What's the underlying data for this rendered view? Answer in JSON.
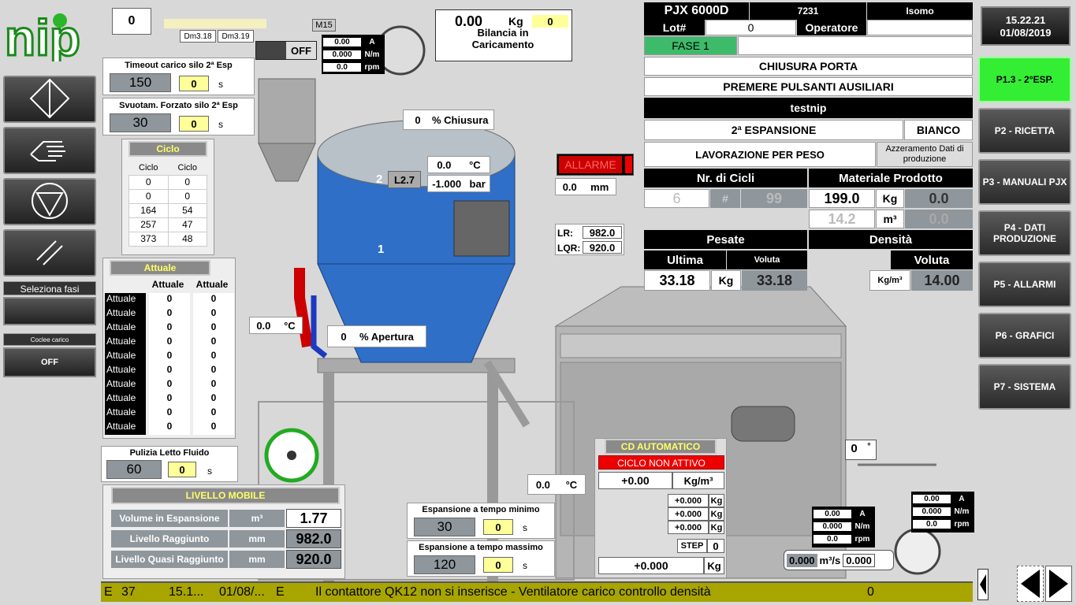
{
  "left": {
    "seleziona_fasi": "Seleziona fasi",
    "coclee_label": "Coclee carico",
    "coclee_value": "OFF"
  },
  "silo": {
    "counter": "0",
    "dm1": "Dm3.18",
    "dm2": "Dm3.19",
    "m15": "M15",
    "off": "OFF"
  },
  "timeout": {
    "title": "Timeout carico silo 2ª Esp",
    "value": "150",
    "actual": "0",
    "unit": "s"
  },
  "svuot": {
    "title": "Svuotam. Forzato silo 2ª Esp",
    "value": "30",
    "actual": "0",
    "unit": "s"
  },
  "ciclo": {
    "header": "Ciclo",
    "col1": "Ciclo",
    "col2": "Ciclo",
    "rows": [
      [
        "0",
        "0"
      ],
      [
        "0",
        "0"
      ],
      [
        "164",
        "54"
      ],
      [
        "257",
        "47"
      ],
      [
        "373",
        "48"
      ]
    ]
  },
  "attuale": {
    "header": "Attuale",
    "col1": "Attuale",
    "col2": "Attuale",
    "row_label": "Attuale",
    "rows": [
      [
        "0",
        "0"
      ],
      [
        "0",
        "0"
      ],
      [
        "0",
        "0"
      ],
      [
        "0",
        "0"
      ],
      [
        "0",
        "0"
      ],
      [
        "0",
        "0"
      ],
      [
        "0",
        "0"
      ],
      [
        "0",
        "0"
      ],
      [
        "0",
        "0"
      ],
      [
        "0",
        "0"
      ]
    ]
  },
  "pulizia": {
    "title": "Pulizia Letto Fluido",
    "value": "60",
    "actual": "0",
    "unit": "s"
  },
  "livello": {
    "header": "LIVELLO MOBILE",
    "rows": [
      {
        "label": "Volume in Espansione",
        "unit": "m³",
        "value": "1.77"
      },
      {
        "label": "Livello Raggiunto",
        "unit": "mm",
        "value": "982.0"
      },
      {
        "label": "Livello Quasi Raggiunto",
        "unit": "mm",
        "value": "920.0"
      }
    ]
  },
  "motor1": {
    "a": "0.00",
    "a_u": "A",
    "nm": "0.000",
    "nm_u": "N/m",
    "rpm": "0.0",
    "rpm_u": "rpm"
  },
  "bilancia": {
    "value": "0.00",
    "unit": "Kg",
    "actual": "0",
    "label": "Bilancia in Caricamento"
  },
  "chiusura": {
    "value": "0",
    "label": "% Chiusura"
  },
  "apertura": {
    "value": "0",
    "label": "% Apertura"
  },
  "tank": {
    "temp": "0.0",
    "temp_u": "°C",
    "bar": "-1.000",
    "bar_u": "bar",
    "l27": "L2.7",
    "n1": "1",
    "n2": "2",
    "t_left": "0.0",
    "t_left_u": "°C",
    "t_bottom": "0.0",
    "t_bottom_u": "°C"
  },
  "allarme": {
    "label": "ALLARME",
    "mm": "0.0",
    "mm_u": "mm"
  },
  "lr": {
    "lr_label": "LR:",
    "lr": "982.0",
    "lqr_label": "LQR:",
    "lqr": "920.0"
  },
  "header": {
    "machine": "PJX 6000D",
    "code": "7231",
    "product": "Isomo",
    "lot_label": "Lot#",
    "lot": "0",
    "operatore_label": "Operatore",
    "operatore": "",
    "fase": "FASE 1"
  },
  "messages": [
    "CHIUSURA PORTA",
    "PREMERE PULSANTI AUSILIARI",
    "testnip"
  ],
  "espansione": {
    "label": "2ª ESPANSIONE",
    "color": "BIANCO",
    "lavorazione": "LAVORAZIONE PER PESO",
    "azzeramento": "Azzeramento Dati di produzione"
  },
  "cicli": {
    "label": "Nr. di Cicli",
    "value": "6",
    "sep": "#",
    "total": "99"
  },
  "materiale": {
    "label": "Materiale Prodotto",
    "kg": "199.0",
    "kg_u": "Kg",
    "kg2": "0.0",
    "m3": "14.2",
    "m3_u": "m³",
    "m32": "0.0"
  },
  "pesate": {
    "label": "Pesate",
    "ultima_label": "Ultima",
    "voluta_label": "Voluta",
    "ultima": "33.18",
    "unit": "Kg",
    "voluta": "33.18"
  },
  "densita": {
    "label": "Densità",
    "voluta_label": "Voluta",
    "unit": "Kg/m³",
    "voluta": "14.00"
  },
  "datetime": {
    "time": "15.22.21",
    "date": "01/08/2019"
  },
  "nav": [
    "P1.3 -  2°ESP.",
    "P2 - RICETTA",
    "P3 - MANUALI PJX",
    "P4 - DATI PRODUZIONE",
    "P5 - ALLARMI",
    "P6 - GRAFICI",
    "P7 - SISTEMA"
  ],
  "espmin": {
    "title": "Espansione a tempo minimo",
    "value": "30",
    "actual": "0",
    "unit": "s"
  },
  "espmax": {
    "title": "Espansione a tempo massimo",
    "value": "120",
    "actual": "0",
    "unit": "s"
  },
  "cd": {
    "header": "CD AUTOMATICO",
    "status": "CICLO NON ATTIVO",
    "val": "+0.00",
    "val_u": "Kg/m³",
    "k1": "+0.000",
    "k2": "+0.000",
    "k3": "+0.000",
    "ku": "Kg",
    "step_label": "STEP",
    "step": "0",
    "total": "+0.000",
    "total_u": "Kg"
  },
  "right_motor1": {
    "a": "0.00",
    "a_u": "A",
    "nm": "0.000",
    "nm_u": "N/m",
    "rpm": "0.0",
    "rpm_u": "rpm"
  },
  "right_motor2": {
    "a": "0.00",
    "a_u": "A",
    "nm": "0.000",
    "nm_u": "N/m",
    "rpm": "0.0",
    "rpm_u": "rpm"
  },
  "flow": {
    "v1": "0.000",
    "unit": "m³/s",
    "v2": "0.000"
  },
  "deg": {
    "value": "0",
    "unit": "°"
  },
  "alarm_bar": {
    "type": "E",
    "num": "37",
    "time": "15.1...",
    "date": "01/08/...",
    "code": "E",
    "text": "Il contattore QK12 non si inserisce - Ventilatore carico controllo densità",
    "count": "0"
  },
  "colors": {
    "accent_green": "#33ee33",
    "alarm_red": "#e00000",
    "bar_olive": "#a8a400"
  }
}
